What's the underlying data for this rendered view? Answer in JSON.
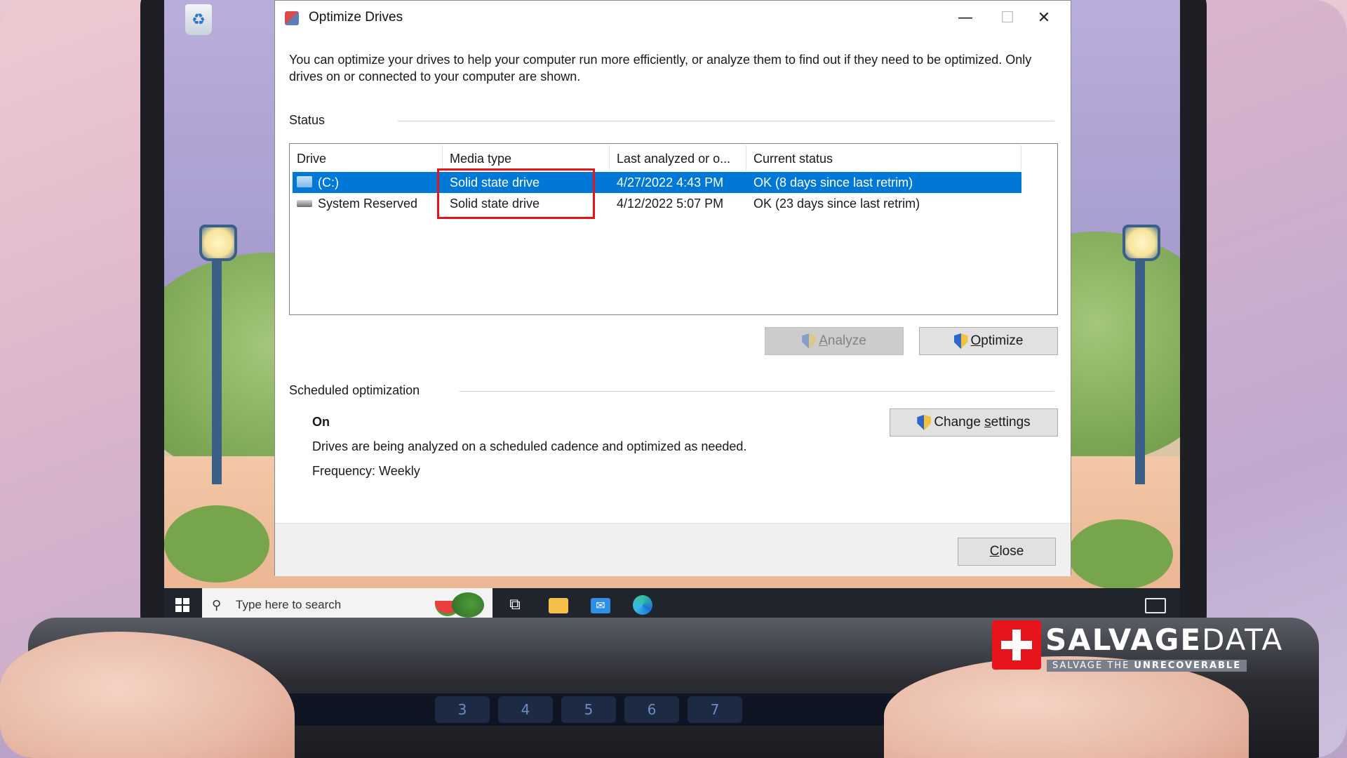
{
  "dialog": {
    "title": "Optimize Drives",
    "controls": {
      "minimize": "—",
      "maximize": "☐",
      "close": "✕"
    },
    "intro": "You can optimize your drives to help your computer run more efficiently, or analyze them to find out if they need to be optimized. Only drives on or connected to your computer are shown.",
    "status_label": "Status",
    "table": {
      "headers": [
        "Drive",
        "Media type",
        "Last analyzed or o...",
        "Current status"
      ],
      "rows": [
        {
          "drive": "(C:)",
          "media_type": "Solid state drive",
          "last_analyzed": "4/27/2022 4:43 PM",
          "status": "OK (8 days since last retrim)",
          "selected": true,
          "icon": "system-drive-icon"
        },
        {
          "drive": "System Reserved",
          "media_type": "Solid state drive",
          "last_analyzed": "4/12/2022 5:07 PM",
          "status": "OK (23 days since last retrim)",
          "selected": false,
          "icon": "drive-icon"
        }
      ]
    },
    "buttons": {
      "analyze": {
        "mnemonic": "A",
        "rest": "nalyze",
        "disabled": true
      },
      "optimize": {
        "mnemonic": "O",
        "rest": "ptimize",
        "disabled": false
      },
      "change_settings": {
        "prefix": "Change ",
        "mnemonic": "s",
        "rest": "ettings"
      },
      "close": {
        "mnemonic": "C",
        "rest": "lose"
      }
    },
    "scheduled": {
      "label": "Scheduled optimization",
      "state": "On",
      "description": "Drives are being analyzed on a scheduled cadence and optimized as needed.",
      "frequency": "Frequency: Weekly"
    }
  },
  "taskbar": {
    "search_placeholder": "Type here to search",
    "icons": [
      "start-icon",
      "search-icon",
      "task-view-icon",
      "file-explorer-icon",
      "mail-icon",
      "edge-icon",
      "notifications-icon"
    ]
  },
  "keyboard": {
    "keys": [
      "3",
      "4",
      "5",
      "6",
      "7"
    ]
  },
  "brand": {
    "name_bold": "SALVAGE",
    "name_light": "DATA",
    "tagline_plain": "SALVAGE THE ",
    "tagline_bold": "UNRECOVERABLE"
  },
  "colors": {
    "selection": "#0078d7",
    "highlight_box": "#e8141c",
    "taskbar": "#20242d",
    "brand_red": "#e8141c"
  }
}
